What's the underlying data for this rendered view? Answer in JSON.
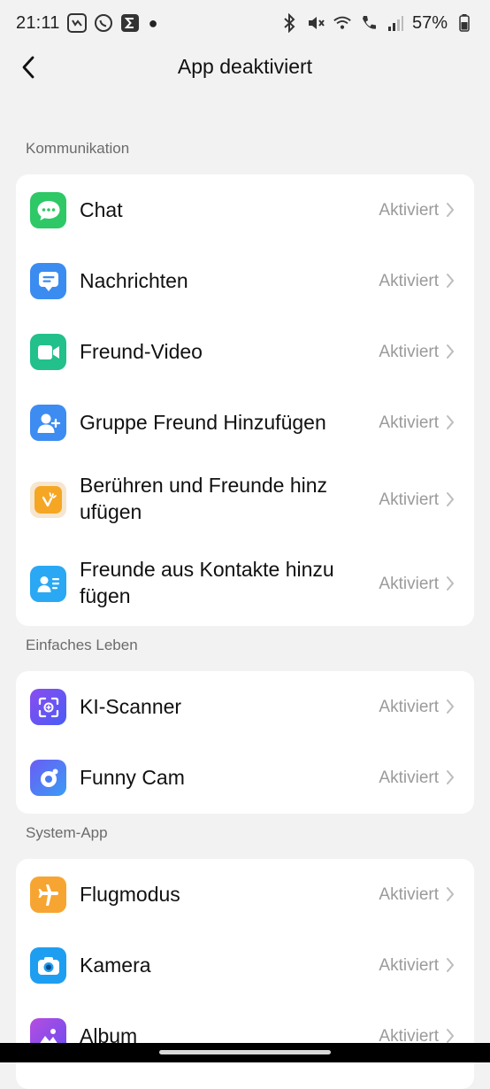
{
  "status_bar": {
    "time": "21:11",
    "battery": "57%"
  },
  "header": {
    "title": "App deaktiviert"
  },
  "sections": [
    {
      "label": "Kommunikation",
      "items": [
        {
          "label": "Chat",
          "status": "Aktiviert",
          "icon": "chat-bubble-icon"
        },
        {
          "label": "Nachrichten",
          "status": "Aktiviert",
          "icon": "message-icon"
        },
        {
          "label": "Freund-Video",
          "status": "Aktiviert",
          "icon": "video-camera-icon"
        },
        {
          "label": "Gruppe Freund Hinzufügen",
          "status": "Aktiviert",
          "icon": "add-user-icon"
        },
        {
          "label": "Berühren und Freunde hinz\nufügen",
          "status": "Aktiviert",
          "icon": "touch-friends-icon"
        },
        {
          "label": "Freunde aus Kontakte hinzu\nfügen",
          "status": "Aktiviert",
          "icon": "contacts-icon"
        }
      ]
    },
    {
      "label": "Einfaches Leben",
      "items": [
        {
          "label": "KI-Scanner",
          "status": "Aktiviert",
          "icon": "scanner-icon"
        },
        {
          "label": "Funny Cam",
          "status": "Aktiviert",
          "icon": "funny-cam-icon"
        }
      ]
    },
    {
      "label": "System-App",
      "items": [
        {
          "label": "Flugmodus",
          "status": "Aktiviert",
          "icon": "airplane-icon"
        },
        {
          "label": "Kamera",
          "status": "Aktiviert",
          "icon": "camera-icon"
        },
        {
          "label": "Album",
          "status": "Aktiviert",
          "icon": "album-icon"
        }
      ]
    }
  ],
  "colors": {
    "chat": "#2ec866",
    "messages": "#3b8cf0",
    "video": "#22c08a",
    "add_user": "#3d8cf2",
    "touch": "#f5a623",
    "contacts": "#2aa8f3",
    "scanner": "#6a4cf5",
    "funny_cam": "#4a7cf5",
    "airplane": "#f7a532",
    "camera": "#1e9ef0",
    "album": "#8b4be0"
  }
}
